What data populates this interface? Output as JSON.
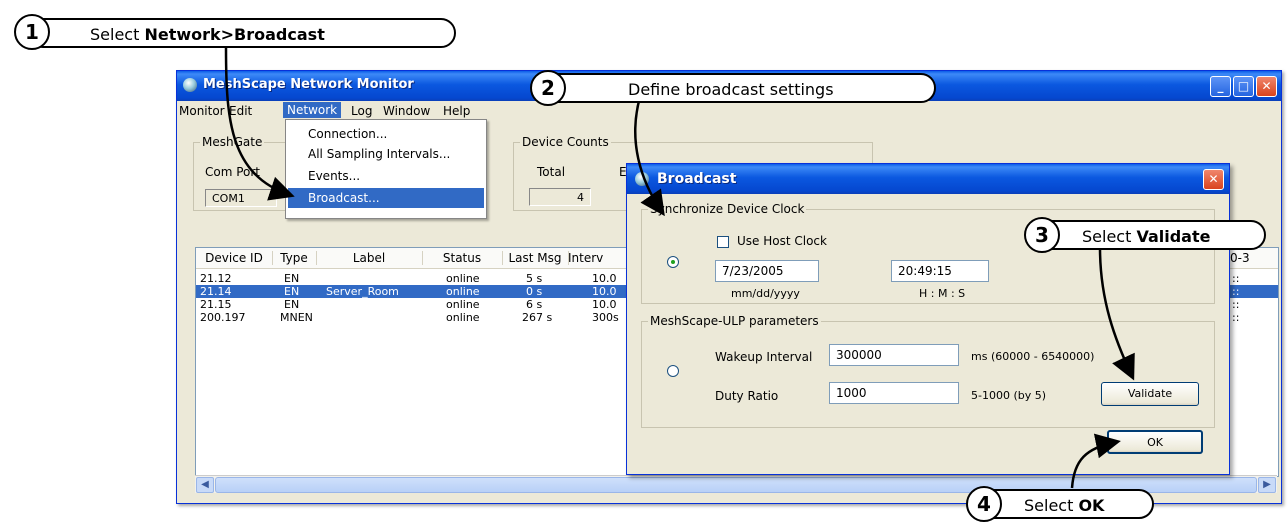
{
  "callouts": {
    "c1": {
      "num": "1",
      "pre": "Select ",
      "bold": "Network>Broadcast"
    },
    "c2": {
      "num": "2",
      "pre": "Define broadcast settings",
      "bold": ""
    },
    "c3": {
      "num": "3",
      "pre": "Select ",
      "bold": "Validate"
    },
    "c4": {
      "num": "4",
      "pre": "Select ",
      "bold": "OK"
    }
  },
  "window": {
    "title": "MeshScape Network Monitor",
    "menu": [
      "Monitor",
      "Edit",
      "Network",
      "Log",
      "Window",
      "Help"
    ],
    "meshgate": {
      "legend": "MeshGate",
      "com_port_label": "Com Port",
      "com_port_value": "COM1"
    },
    "device_counts": {
      "legend": "Device Counts",
      "total_label": "Total",
      "total_value": "4",
      "en_label": "En"
    },
    "network_menu": [
      "Connection...",
      "All Sampling Intervals...",
      "Events...",
      "Broadcast..."
    ],
    "list": {
      "columns": [
        "Device ID",
        "Type",
        "Label",
        "Status",
        "Last Msg",
        "Interv",
        "0-3"
      ],
      "rows": [
        {
          "id": "21.12",
          "type": "EN",
          "label": "",
          "status": "online",
          "last": "5 s",
          "interval": "10.0",
          "extra": "::"
        },
        {
          "id": "21.14",
          "type": "EN",
          "label": "Server_Room",
          "status": "online",
          "last": "0 s",
          "interval": "10.0",
          "extra": "::"
        },
        {
          "id": "21.15",
          "type": "EN",
          "label": "",
          "status": "online",
          "last": "6 s",
          "interval": "10.0",
          "extra": "::"
        },
        {
          "id": "200.197",
          "type": "MNEN",
          "label": "",
          "status": "online",
          "last": "267 s",
          "interval": "300s",
          "extra": "::"
        }
      ]
    }
  },
  "dialog": {
    "title": "Broadcast",
    "sync": {
      "legend": "Synchronize Device Clock",
      "use_host_clock": "Use Host Clock",
      "date": "7/23/2005",
      "date_format": "mm/dd/yyyy",
      "time": "20:49:15",
      "time_format": "H : M : S"
    },
    "ulp": {
      "legend": "MeshScape-ULP parameters",
      "wakeup_label": "Wakeup Interval",
      "wakeup_value": "300000",
      "wakeup_range": "ms (60000 - 6540000)",
      "duty_label": "Duty Ratio",
      "duty_value": "1000",
      "duty_range": "5-1000 (by 5)"
    },
    "validate_label": "Validate",
    "ok_label": "OK"
  }
}
